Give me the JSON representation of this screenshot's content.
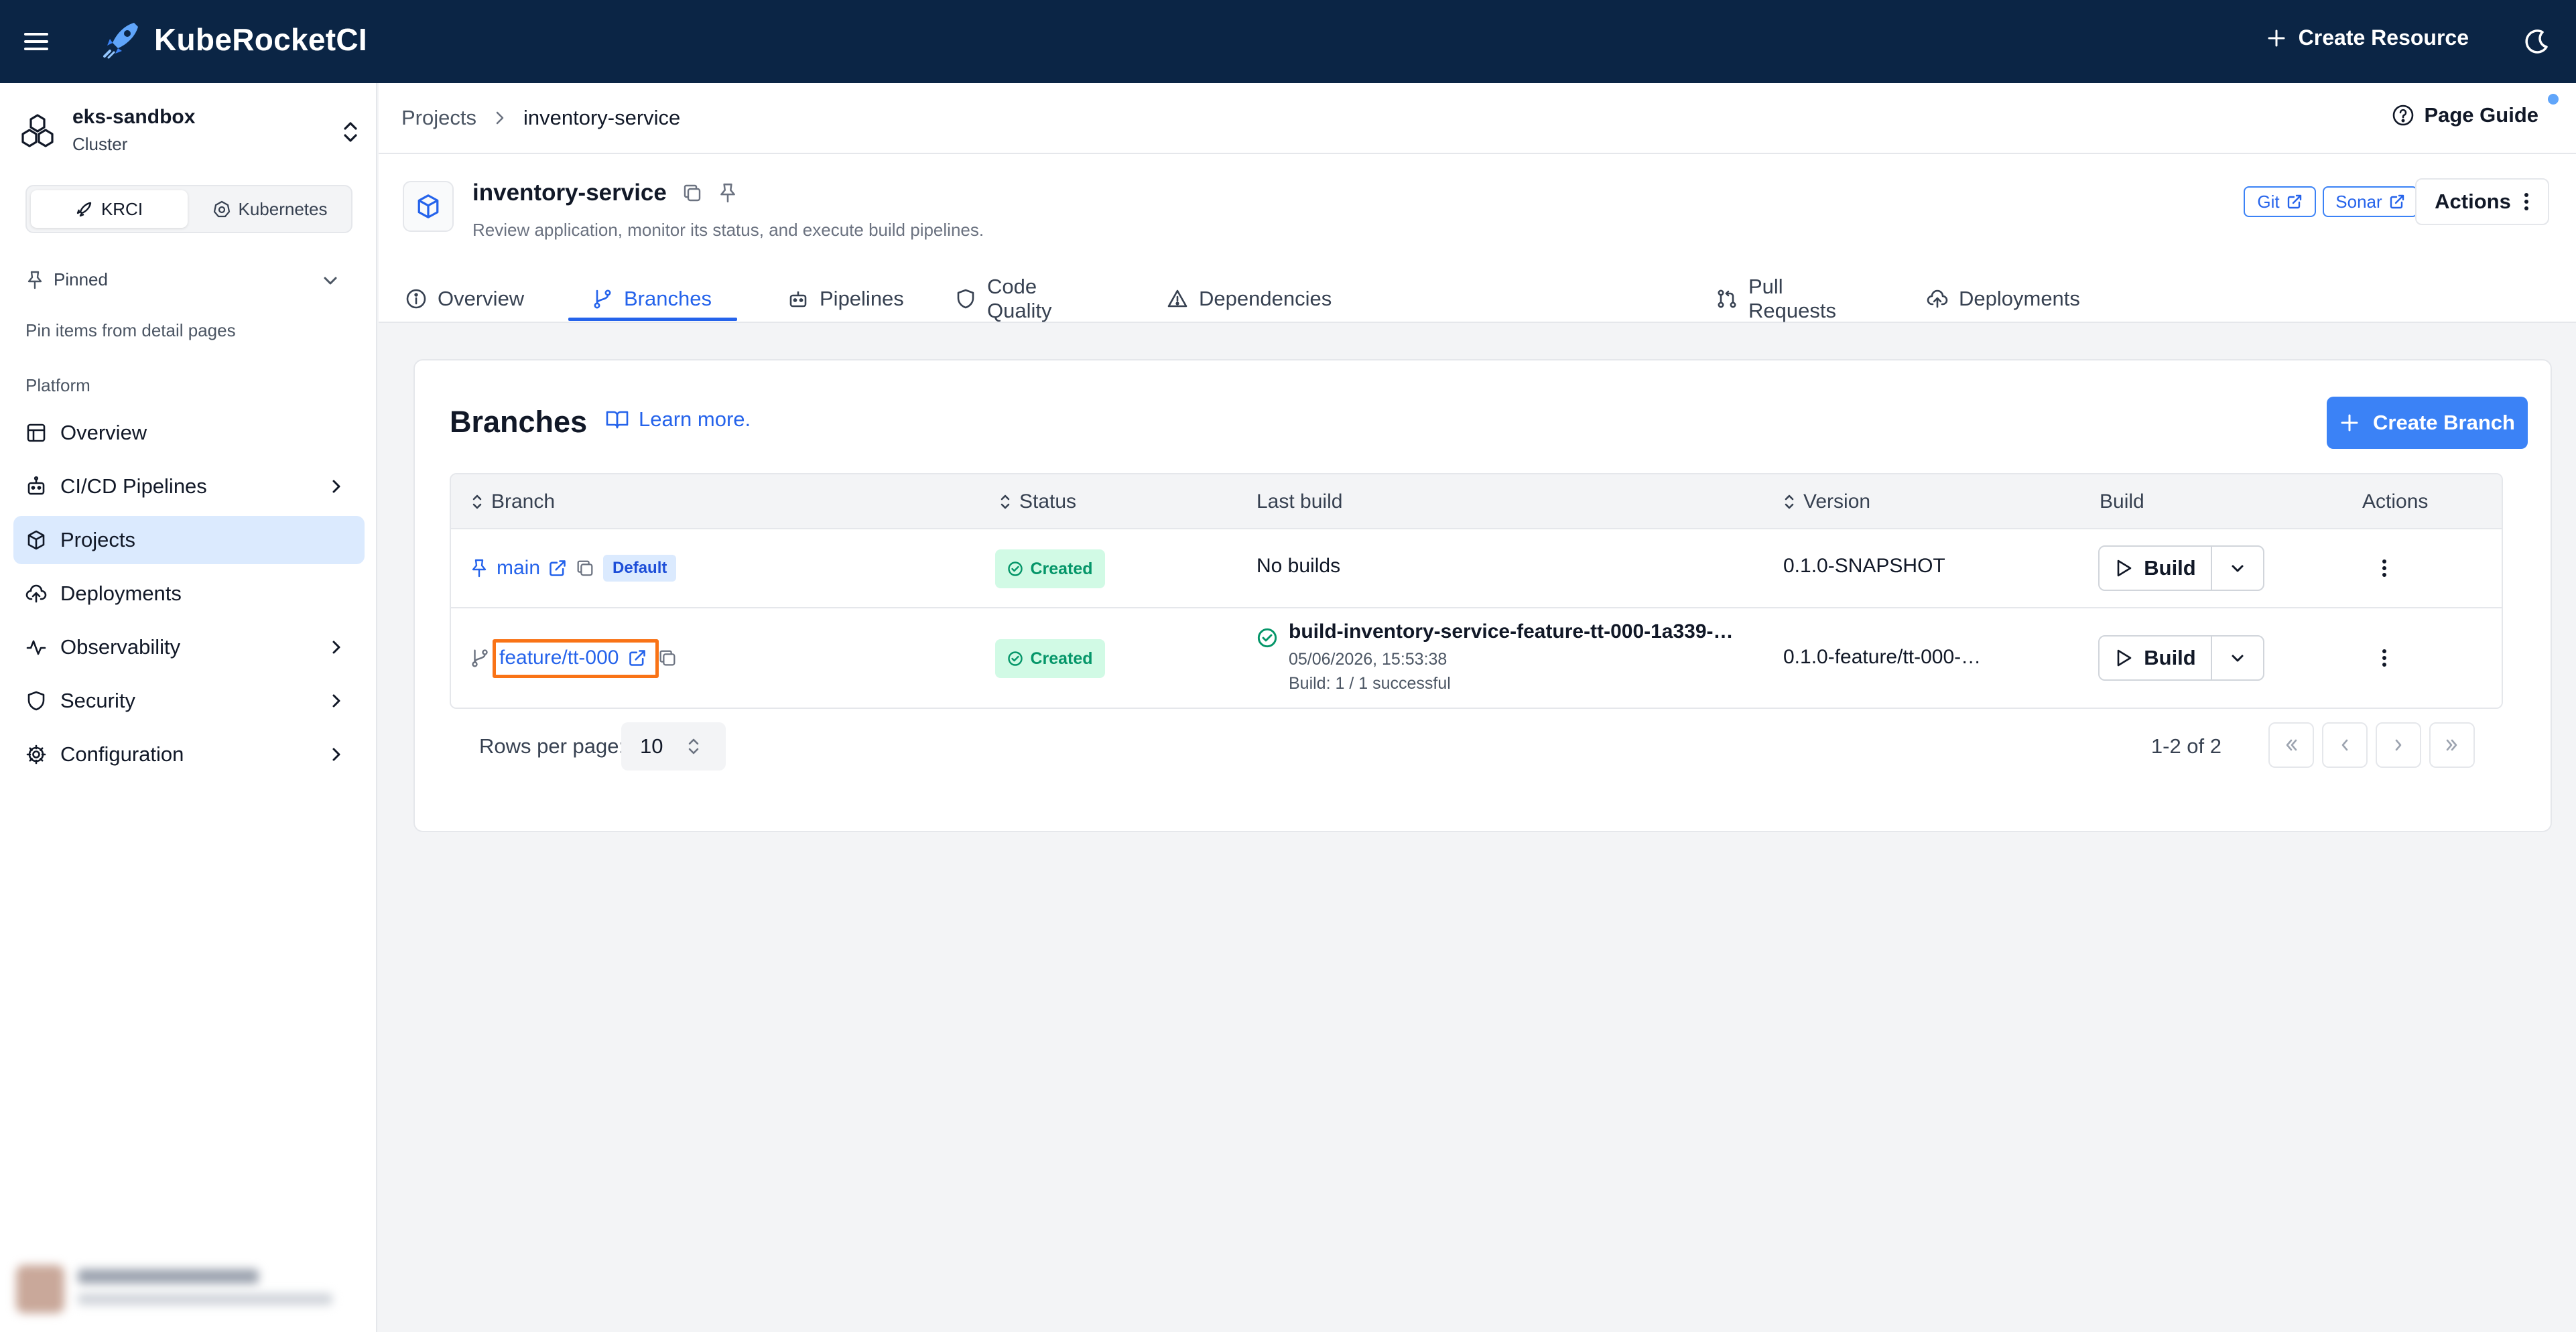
{
  "app": {
    "brand": "KubeRocketCI"
  },
  "header": {
    "create_resource": "Create Resource"
  },
  "sidebar": {
    "cluster_name": "eks-sandbox",
    "cluster_sub": "Cluster",
    "modes": [
      "KRCI",
      "Kubernetes"
    ],
    "pinned_label": "Pinned",
    "pinned_hint": "Pin items from detail pages",
    "platform_label": "Platform",
    "items": [
      {
        "label": "Overview"
      },
      {
        "label": "CI/CD Pipelines"
      },
      {
        "label": "Projects"
      },
      {
        "label": "Deployments"
      },
      {
        "label": "Observability"
      },
      {
        "label": "Security"
      },
      {
        "label": "Configuration"
      }
    ]
  },
  "breadcrumb": {
    "parent": "Projects",
    "current": "inventory-service"
  },
  "page_guide": "Page Guide",
  "project": {
    "name": "inventory-service",
    "description": "Review application, monitor its status, and execute build pipelines.",
    "links": [
      "Git",
      "Sonar"
    ],
    "actions_label": "Actions"
  },
  "tabs": [
    "Overview",
    "Branches",
    "Pipelines",
    "Code Quality",
    "Dependencies",
    "Pull Requests",
    "Deployments"
  ],
  "branches": {
    "title": "Branches",
    "learn_more": "Learn more.",
    "create_button": "Create Branch",
    "columns": [
      "Branch",
      "Status",
      "Last build",
      "Version",
      "Build",
      "Actions"
    ],
    "rows": [
      {
        "branch": "main",
        "default_badge": "Default",
        "status": "Created",
        "last_build": "No builds",
        "version": "0.1.0-SNAPSHOT",
        "build_label": "Build"
      },
      {
        "branch": "feature/tt-000",
        "status": "Created",
        "last_build_name": "build-inventory-service-feature-tt-000-1a339-…",
        "last_build_time": "05/06/2026, 15:53:38",
        "last_build_summary": "Build: 1 / 1 successful",
        "version": "0.1.0-feature/tt-000-…",
        "build_label": "Build"
      }
    ],
    "rows_per_page_label": "Rows per page:",
    "rows_per_page": "10",
    "range": "1-2 of 2"
  },
  "colors": {
    "header_bg": "#0b2545",
    "accent": "#3b82f6",
    "success": "#059669",
    "highlight": "#f97316"
  }
}
